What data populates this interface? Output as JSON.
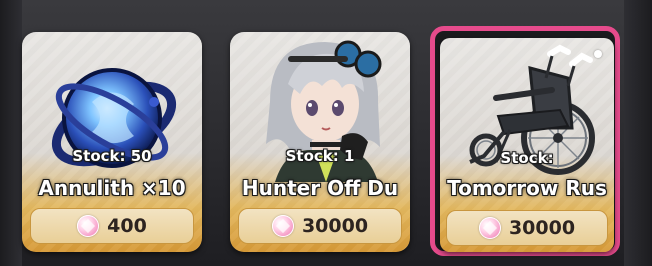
{
  "shop": {
    "items": [
      {
        "name": "Annulith ×10",
        "stock": "Stock: 50",
        "price": "400",
        "icon": "annulith-orb-icon",
        "currency_icon": "pink-gem-icon"
      },
      {
        "name": "Hunter Off Du",
        "stock": "Stock: 1",
        "price": "30000",
        "icon": "character-portrait",
        "currency_icon": "pink-gem-icon"
      },
      {
        "name": "Tomorrow Rus",
        "stock": "Stock:",
        "price": "30000",
        "icon": "wheelchair-icon",
        "currency_icon": "pink-gem-icon",
        "selected": true
      }
    ],
    "colors": {
      "selection": "#e64b8c",
      "price_bar": "#e9cf97",
      "card_bottom": "#d79a37"
    }
  }
}
